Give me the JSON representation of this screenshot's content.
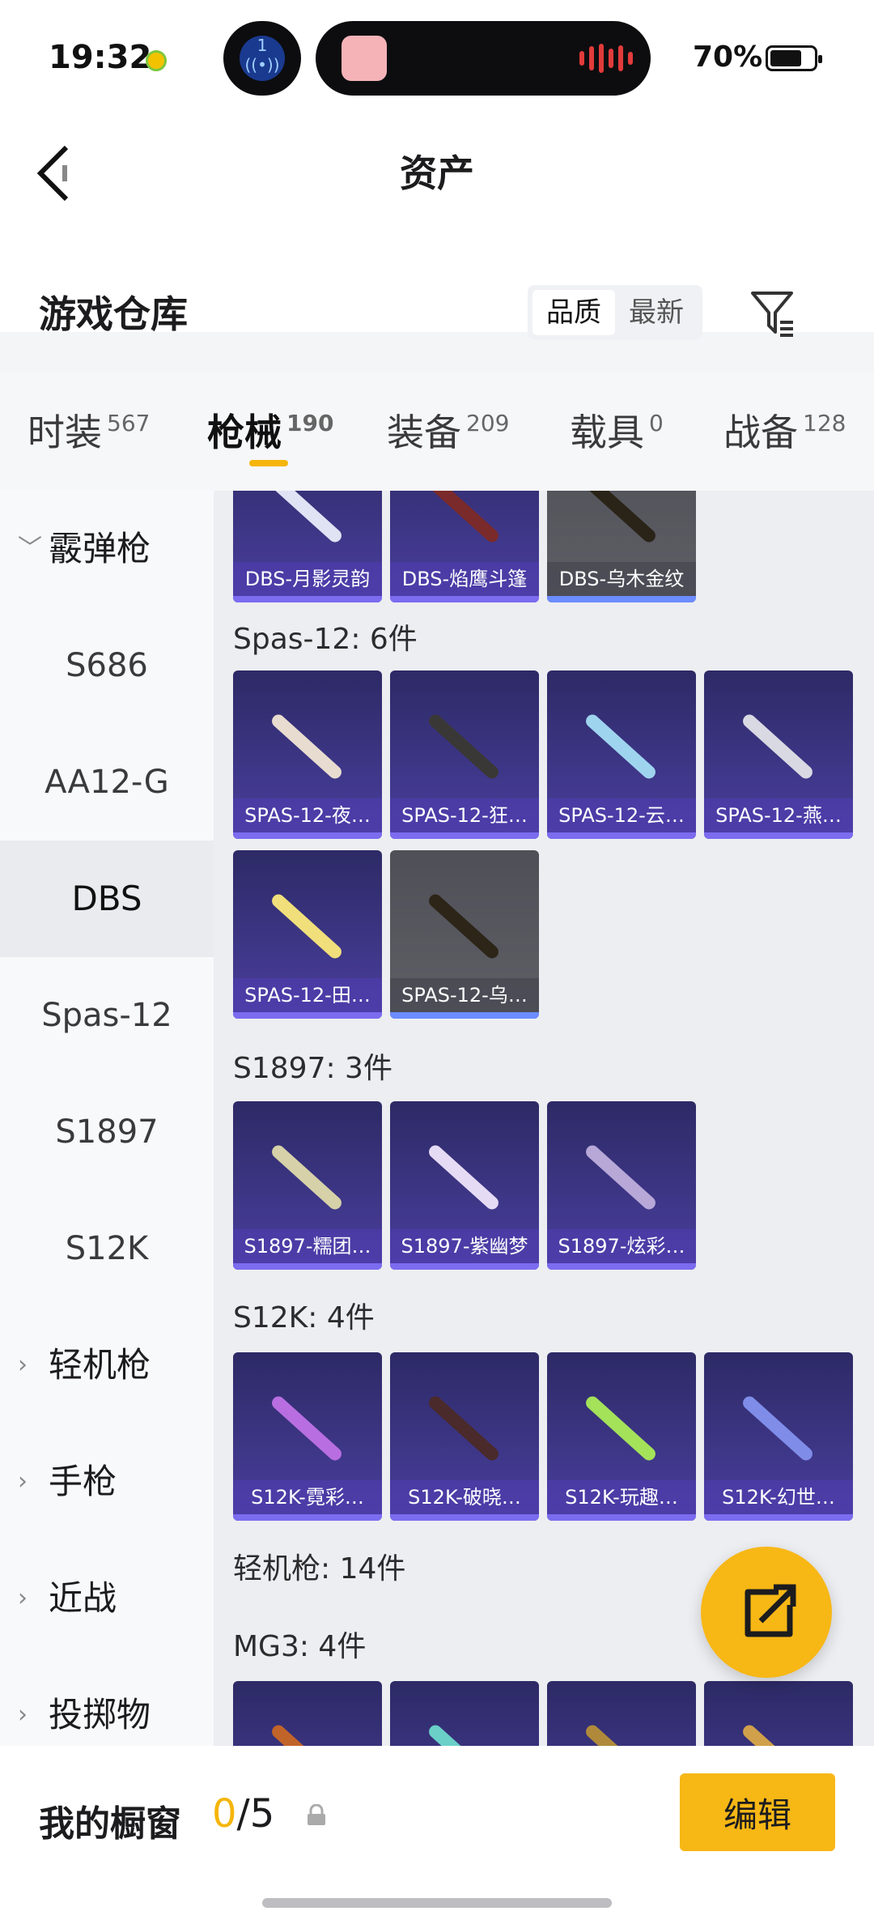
{
  "status_bar": {
    "time": "19:32",
    "pill_number": "1",
    "battery": "70%"
  },
  "header": {
    "title": "资产",
    "section_title": "游戏仓库",
    "sort": [
      "品质",
      "最新"
    ]
  },
  "tabs": [
    {
      "label": "时装",
      "count": "567"
    },
    {
      "label": "枪械",
      "count": "190"
    },
    {
      "label": "装备",
      "count": "209"
    },
    {
      "label": "载具",
      "count": "0"
    },
    {
      "label": "战备",
      "count": "128"
    }
  ],
  "sidenav": [
    {
      "label": "霰弹枪",
      "type": "group",
      "expanded": true
    },
    {
      "label": "S686",
      "type": "sub"
    },
    {
      "label": "AA12-G",
      "type": "sub"
    },
    {
      "label": "DBS",
      "type": "sub",
      "active": true
    },
    {
      "label": "Spas-12",
      "type": "sub"
    },
    {
      "label": "S1897",
      "type": "sub"
    },
    {
      "label": "S12K",
      "type": "sub"
    },
    {
      "label": "轻机枪",
      "type": "group"
    },
    {
      "label": "手枪",
      "type": "group"
    },
    {
      "label": "近战",
      "type": "group"
    },
    {
      "label": "投掷物",
      "type": "group"
    }
  ],
  "content": {
    "dbs_row": [
      "DBS-月影灵韵",
      "DBS-焰鹰斗篷",
      "DBS-乌木金纹"
    ],
    "spas_label": "Spas-12: 6件",
    "spas_items": [
      "SPAS-12-夜…",
      "SPAS-12-狂…",
      "SPAS-12-云…",
      "SPAS-12-燕…",
      "SPAS-12-田…",
      "SPAS-12-乌…"
    ],
    "s1897_label": "S1897: 3件",
    "s1897_items": [
      "S1897-糯团…",
      "S1897-紫幽梦",
      "S1897-炫彩…"
    ],
    "s12k_label": "S12K: 4件",
    "s12k_items": [
      "S12K-霓彩…",
      "S12K-破晓…",
      "S12K-玩趣…",
      "S12K-幻世…"
    ],
    "lmg_label": "轻机枪: 14件",
    "mg3_label": "MG3: 4件"
  },
  "bottom": {
    "label": "我的橱窗",
    "count_current": "0",
    "count_total": "/5",
    "edit": "编辑"
  },
  "colors": {
    "accent": "#f7b715",
    "card_purple": "#3b3590",
    "card_gray": "#55555c"
  }
}
